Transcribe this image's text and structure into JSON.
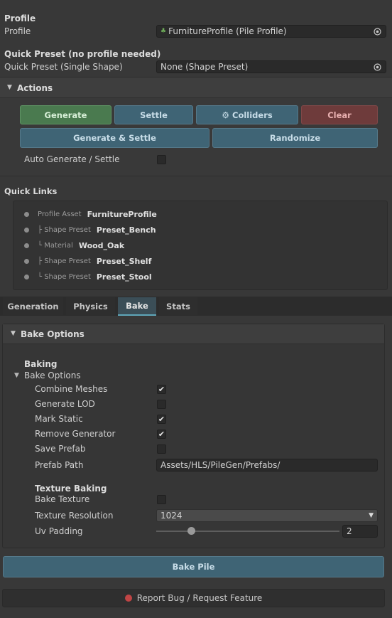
{
  "profile": {
    "header": "Profile",
    "label": "Profile",
    "value": "FurnitureProfile (Pile Profile)"
  },
  "quick_preset": {
    "header": "Quick Preset (no profile needed)",
    "label": "Quick Preset (Single Shape)",
    "value": "None (Shape Preset)"
  },
  "actions": {
    "title": "Actions",
    "generate": "Generate",
    "settle": "Settle",
    "colliders": "Colliders",
    "clear": "Clear",
    "generate_settle": "Generate & Settle",
    "randomize": "Randomize",
    "auto_label": "Auto Generate / Settle"
  },
  "quick_links": {
    "title": "Quick Links",
    "items": [
      {
        "prefix": "Profile Asset",
        "name": "FurnitureProfile"
      },
      {
        "prefix": "├ Shape Preset",
        "name": "Preset_Bench"
      },
      {
        "prefix": "└ Material",
        "name": "Wood_Oak"
      },
      {
        "prefix": "├ Shape Preset",
        "name": "Preset_Shelf"
      },
      {
        "prefix": "└ Shape Preset",
        "name": "Preset_Stool"
      }
    ]
  },
  "tabs": [
    "Generation",
    "Physics",
    "Bake",
    "Stats"
  ],
  "bake": {
    "section_title": "Bake Options",
    "baking_header": "Baking",
    "foldout": "Bake Options",
    "combine": "Combine Meshes",
    "lod": "Generate LOD",
    "static": "Mark Static",
    "remove": "Remove Generator",
    "save_prefab": "Save Prefab",
    "prefab_path_label": "Prefab Path",
    "prefab_path_value": "Assets/HLS/PileGen/Prefabs/",
    "texture_header": "Texture Baking",
    "bake_texture": "Bake Texture",
    "tex_res_label": "Texture Resolution",
    "tex_res_value": "1024",
    "uv_padding_label": "Uv Padding",
    "uv_padding_value": "2",
    "uv_padding_fraction": 0.19,
    "bake_pile": "Bake Pile"
  },
  "checks": {
    "auto": false,
    "combine": true,
    "lod": false,
    "static": true,
    "remove": true,
    "save_prefab": false,
    "bake_texture": false
  },
  "report": "Report Bug / Request Feature",
  "colors": {
    "accent": "#5fa7b9",
    "green": "#4a7a4f",
    "blue": "#3f6475",
    "red": "#6e3b3b"
  }
}
